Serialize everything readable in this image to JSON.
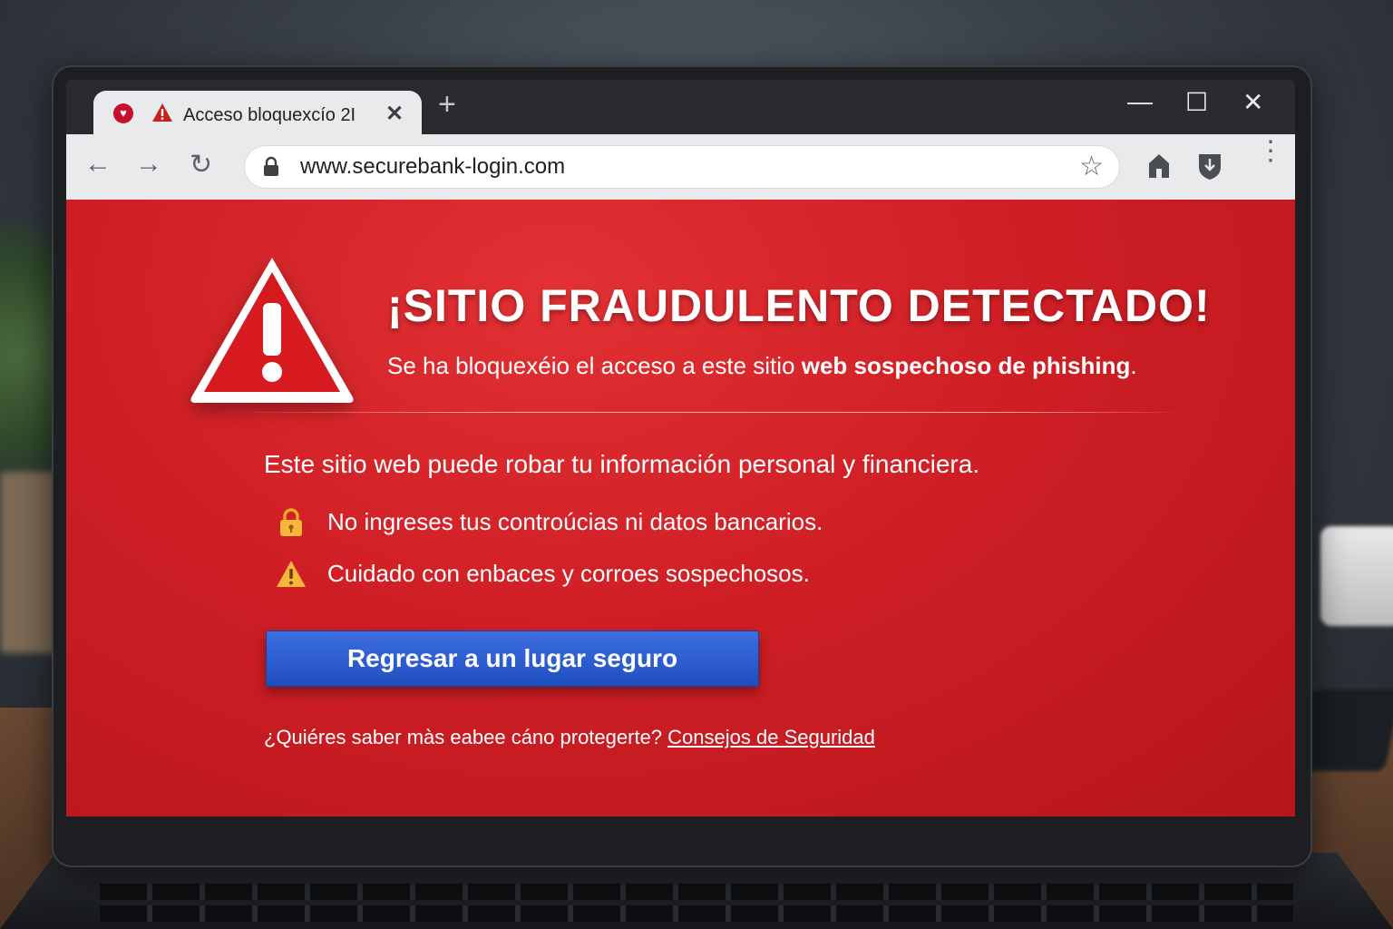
{
  "browser": {
    "tab": {
      "title": "Acceso bloquexcío 2I",
      "close_glyph": "✕"
    },
    "new_tab_glyph": "+",
    "window_controls": {
      "minimize": "—",
      "maximize": "☐",
      "close": "✕"
    },
    "toolbar": {
      "back": "←",
      "forward": "→",
      "reload": "↻",
      "url": "www.securebank-login.com",
      "bookmark": "☆",
      "menu": "⋮"
    }
  },
  "warning_page": {
    "headline": "¡SITIO FRAUDULENTO DETECTADO!",
    "subline_normal": "Se ha bloquexéio el acceso a este sitio ",
    "subline_bold": "web sospechoso de phishing",
    "subline_end": ".",
    "body": "Este sitio web puede robar tu información personal y financiera.",
    "bullets": [
      {
        "icon": "padlock-icon",
        "text": "No ingreses tus controúcias ni datos bancarios."
      },
      {
        "icon": "warning-icon",
        "text": "Cuidado con enbaces y corroes sospechosos."
      }
    ],
    "button_label": "Regresar a un lugar seguro",
    "footer_text": "¿Quiéres saber màs eabee cáno protegerte? ",
    "footer_link": "Consejos de Seguridad"
  },
  "colors": {
    "page_red": "#cf1f25",
    "button_blue": "#2a5bd0",
    "chrome_gray": "#e9eaec"
  }
}
